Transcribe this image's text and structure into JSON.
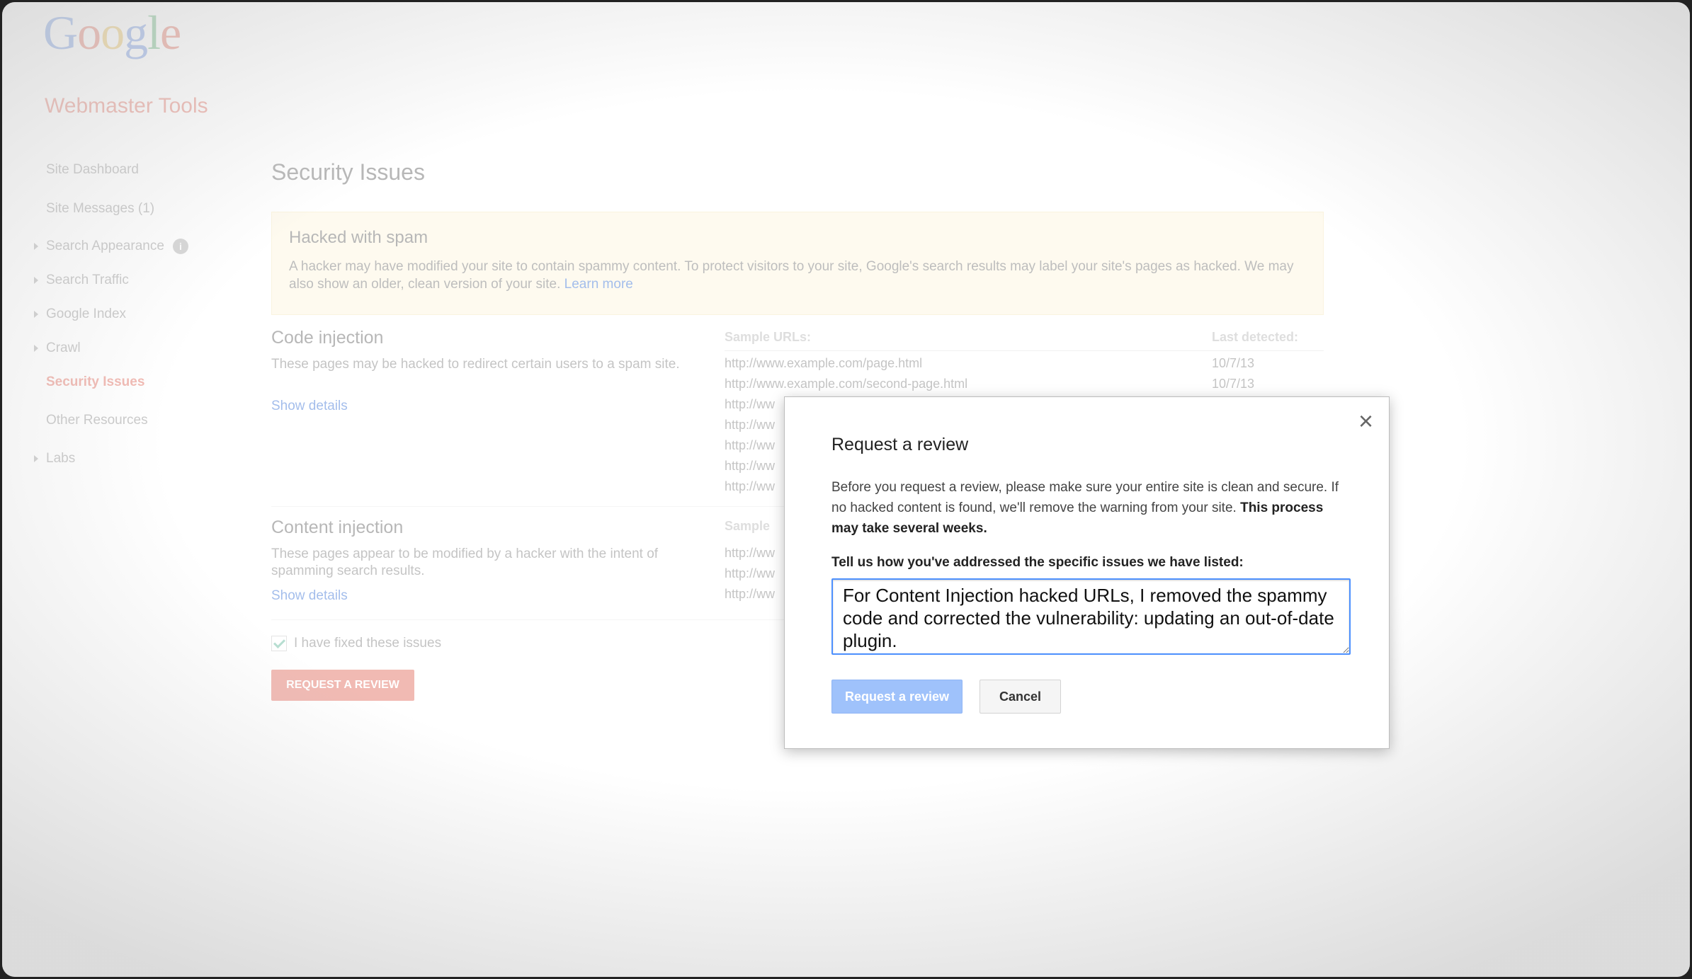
{
  "brand": {
    "logo": "Google",
    "product": "Webmaster Tools"
  },
  "sidebar": {
    "items": [
      {
        "label": "Site Dashboard"
      },
      {
        "label": "Site Messages (1)"
      },
      {
        "label": "Search Appearance"
      },
      {
        "label": "Search Traffic"
      },
      {
        "label": "Google Index"
      },
      {
        "label": "Crawl"
      },
      {
        "label": "Security Issues"
      },
      {
        "label": "Other Resources"
      },
      {
        "label": "Labs"
      }
    ],
    "info_icon": "i"
  },
  "main": {
    "title": "Security Issues",
    "alert": {
      "title": "Hacked with spam",
      "text": "A hacker may have modified your site to contain spammy content. To protect visitors to your site, Google's search results may label your site's pages as hacked. We may also show an older, clean version of your site.",
      "link": "Learn more"
    },
    "headers": {
      "sample_urls": "Sample URLs:",
      "last_detected": "Last detected:"
    },
    "code_injection": {
      "title": "Code injection",
      "desc": "These pages may be hacked to redirect certain users to a spam site.",
      "link": "Show details",
      "rows": [
        {
          "url": "http://www.example.com/page.html",
          "date": "10/7/13"
        },
        {
          "url": "http://www.example.com/second-page.html",
          "date": "10/7/13"
        },
        {
          "url": "http://ww"
        },
        {
          "url": "http://ww"
        },
        {
          "url": "http://ww"
        },
        {
          "url": "http://ww"
        },
        {
          "url": "http://ww"
        }
      ]
    },
    "content_injection": {
      "title": "Content injection",
      "desc": "These pages appear to be modified by a hacker with the intent of spamming search results.",
      "link": "Show details",
      "header_partial": "Sample",
      "rows": [
        {
          "url": "http://ww"
        },
        {
          "url": "http://ww"
        },
        {
          "url": "http://ww"
        }
      ]
    },
    "fixed_label": "I have fixed these issues",
    "request_button": "REQUEST A REVIEW"
  },
  "modal": {
    "close": "×",
    "title": "Request a review",
    "text": "Before you request a review, please make sure your entire site is clean and secure. If no hacked content is found, we'll remove the warning from your site.",
    "text_bold": "This process may take several weeks.",
    "label": "Tell us how you've addressed the specific issues we have listed:",
    "input_value": "For Content Injection hacked URLs, I removed the spammy code and corrected the vulnerability: updating an out-of-date plugin.",
    "submit": "Request a review",
    "cancel": "Cancel"
  },
  "colors": {
    "brand_red": "#dd4b39",
    "link_blue": "#1155cc",
    "alert_bg": "#fdf4d6",
    "focus_blue": "#4d90fe"
  }
}
